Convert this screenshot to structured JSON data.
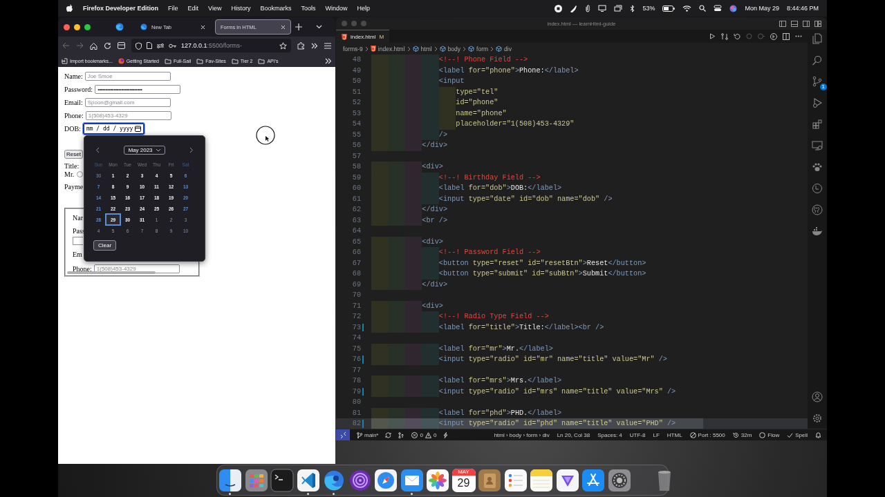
{
  "menubar": {
    "app": "Firefox Developer Edition",
    "menus": [
      "File",
      "Edit",
      "View",
      "History",
      "Bookmarks",
      "Tools",
      "Window",
      "Help"
    ],
    "battery": "53%",
    "date": "Mon May 29",
    "time": "8:44:46 PM"
  },
  "browser": {
    "tabs": [
      {
        "label": "New Tab",
        "selected": false
      },
      {
        "label": "Forms in HTML",
        "selected": true
      }
    ],
    "url": {
      "host": "127.0.0.1",
      "path": ":5500/forms-"
    },
    "bookmarks": [
      {
        "label": "Import bookmarks...",
        "kind": "import"
      },
      {
        "label": "Getting Started",
        "kind": "site"
      },
      {
        "label": "Full-Sail",
        "kind": "folder"
      },
      {
        "label": "Fav-Sites",
        "kind": "folder"
      },
      {
        "label": "Tier 2",
        "kind": "folder"
      },
      {
        "label": "API's",
        "kind": "folder"
      }
    ],
    "form": {
      "fields": [
        {
          "label": "Name:",
          "placeholder": "Joe Smoe"
        },
        {
          "label": "Password:",
          "value": "••••••••••••••••••••••••••••"
        },
        {
          "label": "Email:",
          "placeholder": "Spoon@gmail.com"
        },
        {
          "label": "Phone:",
          "placeholder": "1(508)453-4329"
        }
      ],
      "dob": {
        "label": "DOB:",
        "value": "mm / dd / yyyy",
        "focused": true
      },
      "reset_button": "Reset",
      "title_label": "Title:",
      "radio": {
        "label": "Mr.",
        "checked": false
      },
      "payment_label": "Payme",
      "fieldset": {
        "labels": [
          "Nar",
          "Pass",
          "Em"
        ],
        "phone": {
          "label": "Phone:",
          "placeholder": "1(508)453-4329"
        }
      }
    },
    "date_picker": {
      "month": "May 2023",
      "weekdays": [
        "Sun",
        "Mon",
        "Tue",
        "Wed",
        "Thu",
        "Fri",
        "Sat"
      ],
      "weeks": [
        [
          {
            "day": "30",
            "outside": true,
            "selected": false
          },
          {
            "day": "1",
            "outside": false,
            "selected": false
          },
          {
            "day": "2",
            "outside": false,
            "selected": false
          },
          {
            "day": "3",
            "outside": false,
            "selected": false
          },
          {
            "day": "4",
            "outside": false,
            "selected": false
          },
          {
            "day": "5",
            "outside": false,
            "selected": false
          },
          {
            "day": "6",
            "outside": false,
            "selected": false
          }
        ],
        [
          {
            "day": "7",
            "outside": false,
            "selected": false
          },
          {
            "day": "8",
            "outside": false,
            "selected": false
          },
          {
            "day": "9",
            "outside": false,
            "selected": false
          },
          {
            "day": "10",
            "outside": false,
            "selected": false
          },
          {
            "day": "11",
            "outside": false,
            "selected": false
          },
          {
            "day": "12",
            "outside": false,
            "selected": false
          },
          {
            "day": "13",
            "outside": false,
            "selected": false
          }
        ],
        [
          {
            "day": "14",
            "outside": false,
            "selected": false
          },
          {
            "day": "15",
            "outside": false,
            "selected": false
          },
          {
            "day": "16",
            "outside": false,
            "selected": false
          },
          {
            "day": "17",
            "outside": false,
            "selected": false
          },
          {
            "day": "18",
            "outside": false,
            "selected": false
          },
          {
            "day": "19",
            "outside": false,
            "selected": false
          },
          {
            "day": "20",
            "outside": false,
            "selected": false
          }
        ],
        [
          {
            "day": "21",
            "outside": false,
            "selected": false
          },
          {
            "day": "22",
            "outside": false,
            "selected": false
          },
          {
            "day": "23",
            "outside": false,
            "selected": false
          },
          {
            "day": "24",
            "outside": false,
            "selected": false
          },
          {
            "day": "25",
            "outside": false,
            "selected": false
          },
          {
            "day": "26",
            "outside": false,
            "selected": false
          },
          {
            "day": "27",
            "outside": false,
            "selected": false
          }
        ],
        [
          {
            "day": "28",
            "outside": false,
            "selected": false
          },
          {
            "day": "29",
            "outside": false,
            "selected": true
          },
          {
            "day": "30",
            "outside": false,
            "selected": false
          },
          {
            "day": "31",
            "outside": false,
            "selected": false
          },
          {
            "day": "1",
            "outside": true,
            "selected": false
          },
          {
            "day": "2",
            "outside": true,
            "selected": false
          },
          {
            "day": "3",
            "outside": true,
            "selected": false
          }
        ],
        [
          {
            "day": "4",
            "outside": true,
            "selected": false
          },
          {
            "day": "5",
            "outside": true,
            "selected": false
          },
          {
            "day": "6",
            "outside": true,
            "selected": false
          },
          {
            "day": "7",
            "outside": true,
            "selected": false
          },
          {
            "day": "8",
            "outside": true,
            "selected": false
          },
          {
            "day": "9",
            "outside": true,
            "selected": false
          },
          {
            "day": "10",
            "outside": true,
            "selected": false
          }
        ]
      ],
      "clear": "Clear"
    }
  },
  "editor": {
    "window_title": "index.html — learnHtml-guide",
    "tab": {
      "label": "index.html",
      "badge": "M",
      "selected": true
    },
    "breadcrumbs": [
      {
        "label": "forms-9",
        "kind": "folder"
      },
      {
        "label": "index.html",
        "kind": "file"
      },
      {
        "label": "html",
        "kind": "element"
      },
      {
        "label": "body",
        "kind": "element"
      },
      {
        "label": "form",
        "kind": "element"
      },
      {
        "label": "div",
        "kind": "element"
      }
    ],
    "lines": [
      {
        "n": "48",
        "selected": false,
        "modified": false,
        "t": [
          {
            "kind": "comment",
            "text": "                <!--! Phone Field -->"
          }
        ]
      },
      {
        "n": "49",
        "selected": false,
        "modified": false,
        "t": [
          {
            "kind": "tag",
            "text": "                <label "
          },
          {
            "kind": "attr",
            "text": "for=\"phone\""
          },
          {
            "kind": "tag",
            "text": ">"
          },
          {
            "kind": "text",
            "text": "Phone:"
          },
          {
            "kind": "tag",
            "text": "</label>"
          }
        ]
      },
      {
        "n": "50",
        "selected": false,
        "modified": false,
        "t": [
          {
            "kind": "tag",
            "text": "                <input"
          }
        ]
      },
      {
        "n": "51",
        "selected": false,
        "modified": false,
        "t": [
          {
            "kind": "attr",
            "text": "                    type=\"tel\""
          }
        ]
      },
      {
        "n": "52",
        "selected": false,
        "modified": false,
        "t": [
          {
            "kind": "attr",
            "text": "                    id=\"phone\""
          }
        ]
      },
      {
        "n": "53",
        "selected": false,
        "modified": false,
        "t": [
          {
            "kind": "attr",
            "text": "                    name=\"phone\""
          }
        ]
      },
      {
        "n": "54",
        "selected": false,
        "modified": false,
        "t": [
          {
            "kind": "attr",
            "text": "                    placeholder=\"1(508)453-4329\""
          }
        ]
      },
      {
        "n": "55",
        "selected": false,
        "modified": false,
        "t": [
          {
            "kind": "tag",
            "text": "                />"
          }
        ]
      },
      {
        "n": "56",
        "selected": false,
        "modified": false,
        "t": [
          {
            "kind": "tag",
            "text": "            </div>"
          }
        ]
      },
      {
        "n": "57",
        "selected": false,
        "modified": false
      },
      {
        "n": "58",
        "selected": false,
        "modified": false,
        "t": [
          {
            "kind": "tag",
            "text": "            <div>"
          }
        ]
      },
      {
        "n": "59",
        "selected": false,
        "modified": false,
        "t": [
          {
            "kind": "comment",
            "text": "                <!--! Birthday Field -->"
          }
        ]
      },
      {
        "n": "60",
        "selected": false,
        "modified": false,
        "t": [
          {
            "kind": "tag",
            "text": "                <label "
          },
          {
            "kind": "attr",
            "text": "for=\"dob\""
          },
          {
            "kind": "tag",
            "text": ">"
          },
          {
            "kind": "text",
            "text": "DOB:"
          },
          {
            "kind": "tag",
            "text": "</label>"
          }
        ]
      },
      {
        "n": "61",
        "selected": false,
        "modified": false,
        "t": [
          {
            "kind": "tag",
            "text": "                <input "
          },
          {
            "kind": "attr",
            "text": "type=\"date\" id=\"dob\" name=\"dob\""
          },
          {
            "kind": "tag",
            "text": " />"
          }
        ]
      },
      {
        "n": "62",
        "selected": false,
        "modified": false,
        "t": [
          {
            "kind": "tag",
            "text": "            </div>"
          }
        ]
      },
      {
        "n": "63",
        "selected": false,
        "modified": false,
        "t": [
          {
            "kind": "tag",
            "text": "            <br />"
          }
        ]
      },
      {
        "n": "64",
        "selected": false,
        "modified": false
      },
      {
        "n": "65",
        "selected": false,
        "modified": false,
        "t": [
          {
            "kind": "tag",
            "text": "            <div>"
          }
        ]
      },
      {
        "n": "66",
        "selected": false,
        "modified": false,
        "t": [
          {
            "kind": "comment",
            "text": "                <!--! Password Field -->"
          }
        ]
      },
      {
        "n": "67",
        "selected": false,
        "modified": false,
        "t": [
          {
            "kind": "tag",
            "text": "                <button "
          },
          {
            "kind": "attr",
            "text": "type=\"reset\" id=\"resetBtn\""
          },
          {
            "kind": "tag",
            "text": ">"
          },
          {
            "kind": "text",
            "text": "Reset"
          },
          {
            "kind": "tag",
            "text": "</button>"
          }
        ]
      },
      {
        "n": "68",
        "selected": false,
        "modified": false,
        "t": [
          {
            "kind": "tag",
            "text": "                <button "
          },
          {
            "kind": "attr",
            "text": "type=\"submit\" id=\"subBtn\""
          },
          {
            "kind": "tag",
            "text": ">"
          },
          {
            "kind": "text",
            "text": "Submit"
          },
          {
            "kind": "tag",
            "text": "</button>"
          }
        ]
      },
      {
        "n": "69",
        "selected": false,
        "modified": false,
        "t": [
          {
            "kind": "tag",
            "text": "            </div>"
          }
        ]
      },
      {
        "n": "70",
        "selected": false,
        "modified": false
      },
      {
        "n": "71",
        "selected": false,
        "modified": false,
        "t": [
          {
            "kind": "tag",
            "text": "            <div>"
          }
        ]
      },
      {
        "n": "72",
        "selected": false,
        "modified": false,
        "t": [
          {
            "kind": "comment",
            "text": "                <!--! Radio Type Field -->"
          }
        ]
      },
      {
        "n": "73",
        "selected": false,
        "modified": true,
        "t": [
          {
            "kind": "tag",
            "text": "                <label "
          },
          {
            "kind": "attr",
            "text": "for=\"title\""
          },
          {
            "kind": "tag",
            "text": ">"
          },
          {
            "kind": "text",
            "text": "Title:"
          },
          {
            "kind": "tag",
            "text": "</label><br />"
          }
        ]
      },
      {
        "n": "74",
        "selected": false,
        "modified": false
      },
      {
        "n": "75",
        "selected": false,
        "modified": false,
        "t": [
          {
            "kind": "tag",
            "text": "                <label "
          },
          {
            "kind": "attr",
            "text": "for=\"mr\""
          },
          {
            "kind": "tag",
            "text": ">"
          },
          {
            "kind": "text",
            "text": "Mr."
          },
          {
            "kind": "tag",
            "text": "</label>"
          }
        ]
      },
      {
        "n": "76",
        "selected": false,
        "modified": true,
        "t": [
          {
            "kind": "tag",
            "text": "                <input "
          },
          {
            "kind": "attr",
            "text": "type=\"radio\" id=\"mr\" name=\"title\" value=\"Mr\""
          },
          {
            "kind": "tag",
            "text": " />"
          }
        ]
      },
      {
        "n": "77",
        "selected": false,
        "modified": false
      },
      {
        "n": "78",
        "selected": false,
        "modified": false,
        "t": [
          {
            "kind": "tag",
            "text": "                <label "
          },
          {
            "kind": "attr",
            "text": "for=\"mrs\""
          },
          {
            "kind": "tag",
            "text": ">"
          },
          {
            "kind": "text",
            "text": "Mrs."
          },
          {
            "kind": "tag",
            "text": "</label>"
          }
        ]
      },
      {
        "n": "79",
        "selected": false,
        "modified": true,
        "t": [
          {
            "kind": "tag",
            "text": "                <input "
          },
          {
            "kind": "attr",
            "text": "type=\"radio\" id=\"mrs\" name=\"title\" value=\"Mrs\""
          },
          {
            "kind": "tag",
            "text": " />"
          }
        ]
      },
      {
        "n": "80",
        "selected": false,
        "modified": false
      },
      {
        "n": "81",
        "selected": false,
        "modified": false,
        "t": [
          {
            "kind": "tag",
            "text": "                <label "
          },
          {
            "kind": "attr",
            "text": "for=\"phd\""
          },
          {
            "kind": "tag",
            "text": ">"
          },
          {
            "kind": "text",
            "text": "PHD."
          },
          {
            "kind": "tag",
            "text": "</label>"
          }
        ]
      },
      {
        "n": "82",
        "selected": true,
        "modified": true,
        "t": [
          {
            "kind": "tag",
            "text": "                <input "
          },
          {
            "kind": "attr",
            "text": "type=\"radio\" id=\"phd\" name=\"title\" value=\"PHD\""
          },
          {
            "kind": "tag",
            "text": " />"
          }
        ]
      }
    ],
    "source_control_badge": "1",
    "status": {
      "branch": "main*",
      "errors": "0",
      "warnings": "0",
      "path": "html › body › form › div",
      "position": "Ln 20, Col 38",
      "spaces": "Spaces: 4",
      "encoding": "UTF-8",
      "eol": "LF",
      "language": "HTML",
      "port": "Port : 5500",
      "time": "32m",
      "flow": "Flow",
      "spell": "Spell"
    }
  },
  "dock": [
    {
      "kind": "finder",
      "running": true
    },
    {
      "kind": "launchpad",
      "running": false
    },
    {
      "kind": "terminal",
      "running": false
    },
    {
      "kind": "code",
      "running": true
    },
    {
      "kind": "browser",
      "running": true
    },
    {
      "kind": "onion",
      "running": false
    },
    {
      "kind": "compass",
      "running": false
    },
    {
      "kind": "mail",
      "running": true
    },
    {
      "kind": "photos",
      "running": false
    },
    {
      "kind": "calendar",
      "month": "MAY",
      "day": "29",
      "running": false
    },
    {
      "kind": "contacts",
      "running": false
    },
    {
      "kind": "reminders",
      "running": false
    },
    {
      "kind": "notes",
      "running": false
    },
    {
      "kind": "vpn",
      "running": false
    },
    {
      "kind": "store",
      "running": false
    },
    {
      "kind": "settings",
      "running": false
    },
    {
      "kind": "trash",
      "running": false
    }
  ]
}
